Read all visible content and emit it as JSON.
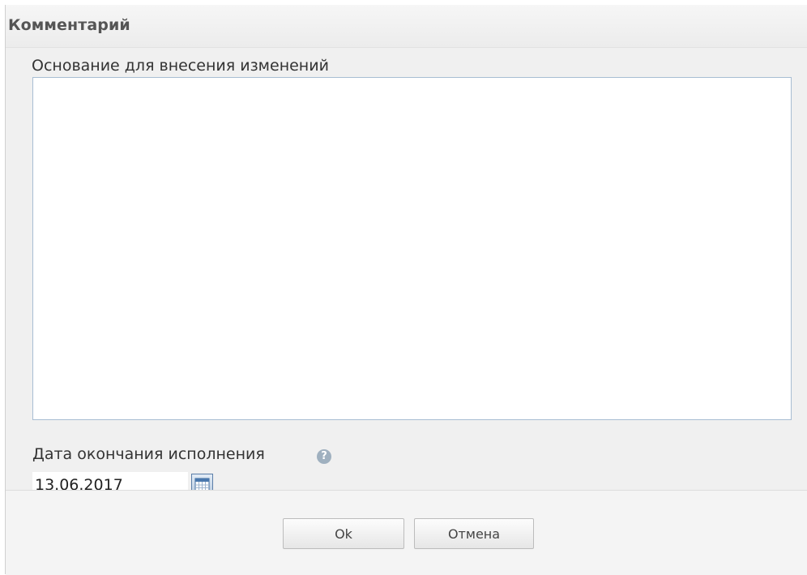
{
  "dialog": {
    "title": "Комментарий"
  },
  "basis": {
    "label": "Основание для внесения изменений",
    "value": ""
  },
  "end_date": {
    "label": "Дата окончания исполнения",
    "value": "13.06.2017",
    "help_icon": "question-circle-icon",
    "calendar_icon": "calendar-icon"
  },
  "buttons": {
    "ok_label": "Ok",
    "cancel_label": "Отмена"
  },
  "colors": {
    "panel_background": "#f0f0f0",
    "field_border": "#a8bdd3",
    "help_icon": "#9fb0bf"
  }
}
